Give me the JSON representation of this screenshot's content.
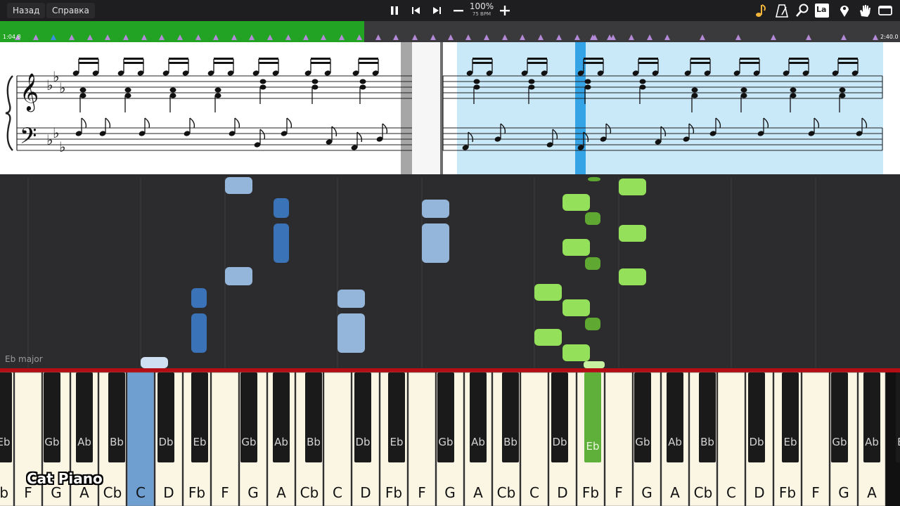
{
  "toolbar": {
    "back_label": "Назад",
    "help_label": "Справка",
    "zoom_percent": "100%",
    "tempo": "75 BPM",
    "right_icons": [
      "note-icon",
      "metronome-icon",
      "magnifier-icon",
      "note-label-icon",
      "location-pin-icon",
      "hand-icon",
      "window-icon"
    ],
    "note_label_text": "La"
  },
  "timeline": {
    "current_time": "1:04.8",
    "total_time": "2:40.0",
    "progress_fraction": 0.405,
    "played_color": "#22a323",
    "marker_color": "#b48ad8"
  },
  "roll": {
    "key_signature": "Eb major",
    "left_hand_color": "#3b73b9",
    "left_hand_light": "#94b6da",
    "right_hand_color": "#94e05a",
    "right_hand_dark": "#5fa832"
  },
  "keyboard": {
    "white_keys": [
      "Fb",
      "F",
      "G",
      "A",
      "Cb",
      "C",
      "D",
      "Fb",
      "F",
      "G",
      "A",
      "Cb",
      "C",
      "D",
      "Fb",
      "F",
      "G",
      "A",
      "Cb",
      "C",
      "D",
      "Fb",
      "F",
      "G",
      "A",
      "Cb",
      "C",
      "D",
      "Fb",
      "F",
      "G",
      "A"
    ],
    "black_keys": [
      "Eb",
      "Gb",
      "Ab",
      "Bb",
      "Db",
      "Eb",
      "Gb",
      "Ab",
      "Bb",
      "Db",
      "Eb",
      "Gb",
      "Ab",
      "Bb",
      "Db",
      "Eb",
      "Gb",
      "Ab",
      "Bb",
      "Db",
      "Eb",
      "Gb",
      "Ab",
      "Bb"
    ],
    "pressed_blue_white_index": 5,
    "pressed_green_black_index": 15,
    "pressed_blue": "#6e9fd0",
    "pressed_green": "#5fb03a"
  },
  "watermark": "Cat Piano"
}
